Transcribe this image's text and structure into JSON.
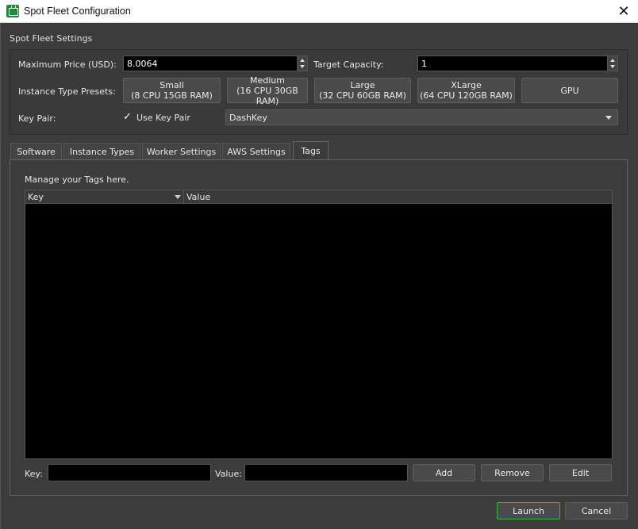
{
  "window": {
    "title": "Spot Fleet Configuration",
    "close_glyph": "✕"
  },
  "settings": {
    "section_label": "Spot Fleet Settings",
    "max_price_label": "Maximum Price (USD):",
    "max_price_value": "8.0064",
    "target_capacity_label": "Target Capacity:",
    "target_capacity_value": "1",
    "presets_label": "Instance Type Presets:",
    "presets": [
      {
        "name": "Small",
        "detail": "(8 CPU 15GB RAM)"
      },
      {
        "name": "Medium",
        "detail": "(16 CPU 30GB RAM)"
      },
      {
        "name": "Large",
        "detail": "(32 CPU 60GB RAM)"
      },
      {
        "name": "XLarge",
        "detail": "(64 CPU 120GB RAM)"
      },
      {
        "name": "GPU",
        "detail": ""
      }
    ],
    "key_pair_label": "Key Pair:",
    "use_key_pair_label": "Use Key Pair",
    "use_key_pair_checked": true,
    "key_pair_value": "DashKey"
  },
  "tabs": [
    "Software",
    "Instance Types",
    "Worker Settings",
    "AWS Settings",
    "Tags"
  ],
  "active_tab": "Tags",
  "tags": {
    "manage_text": "Manage your Tags here.",
    "columns": [
      "Key",
      "Value"
    ],
    "rows": [],
    "key_label": "Key:",
    "value_label": "Value:",
    "key_input": "",
    "value_input": "",
    "add_label": "Add",
    "remove_label": "Remove",
    "edit_label": "Edit"
  },
  "footer": {
    "launch_label": "Launch",
    "cancel_label": "Cancel"
  },
  "colors": {
    "accent_green": "#3fb63f",
    "background": "#3c3c3c",
    "field_bg": "#000000"
  }
}
